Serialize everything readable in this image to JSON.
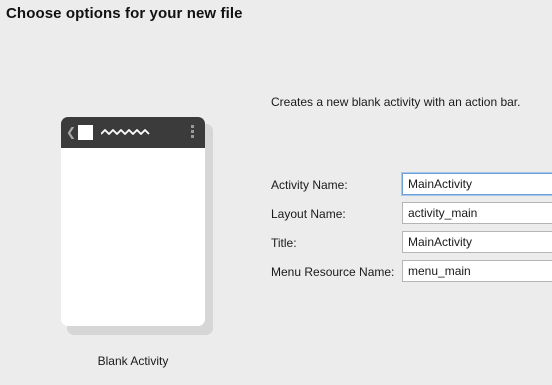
{
  "page": {
    "title": "Choose options for your new file"
  },
  "template": {
    "name": "Blank Activity",
    "description": "Creates a new blank activity with an action bar.",
    "preview": {
      "action_bar_color": "#3b3b3b",
      "icons": [
        "back-chevron-icon",
        "app-icon",
        "title-squiggle-icon",
        "overflow-menu-icon"
      ]
    }
  },
  "form": {
    "fields": [
      {
        "label": "Activity Name:",
        "value": "MainActivity",
        "focused": true
      },
      {
        "label": "Layout Name:",
        "value": "activity_main",
        "focused": false
      },
      {
        "label": "Title:",
        "value": "MainActivity",
        "focused": false
      },
      {
        "label": "Menu Resource Name:",
        "value": "menu_main",
        "focused": false
      }
    ]
  },
  "colors": {
    "background": "#ececec",
    "focus_border": "#6b9fd6"
  }
}
